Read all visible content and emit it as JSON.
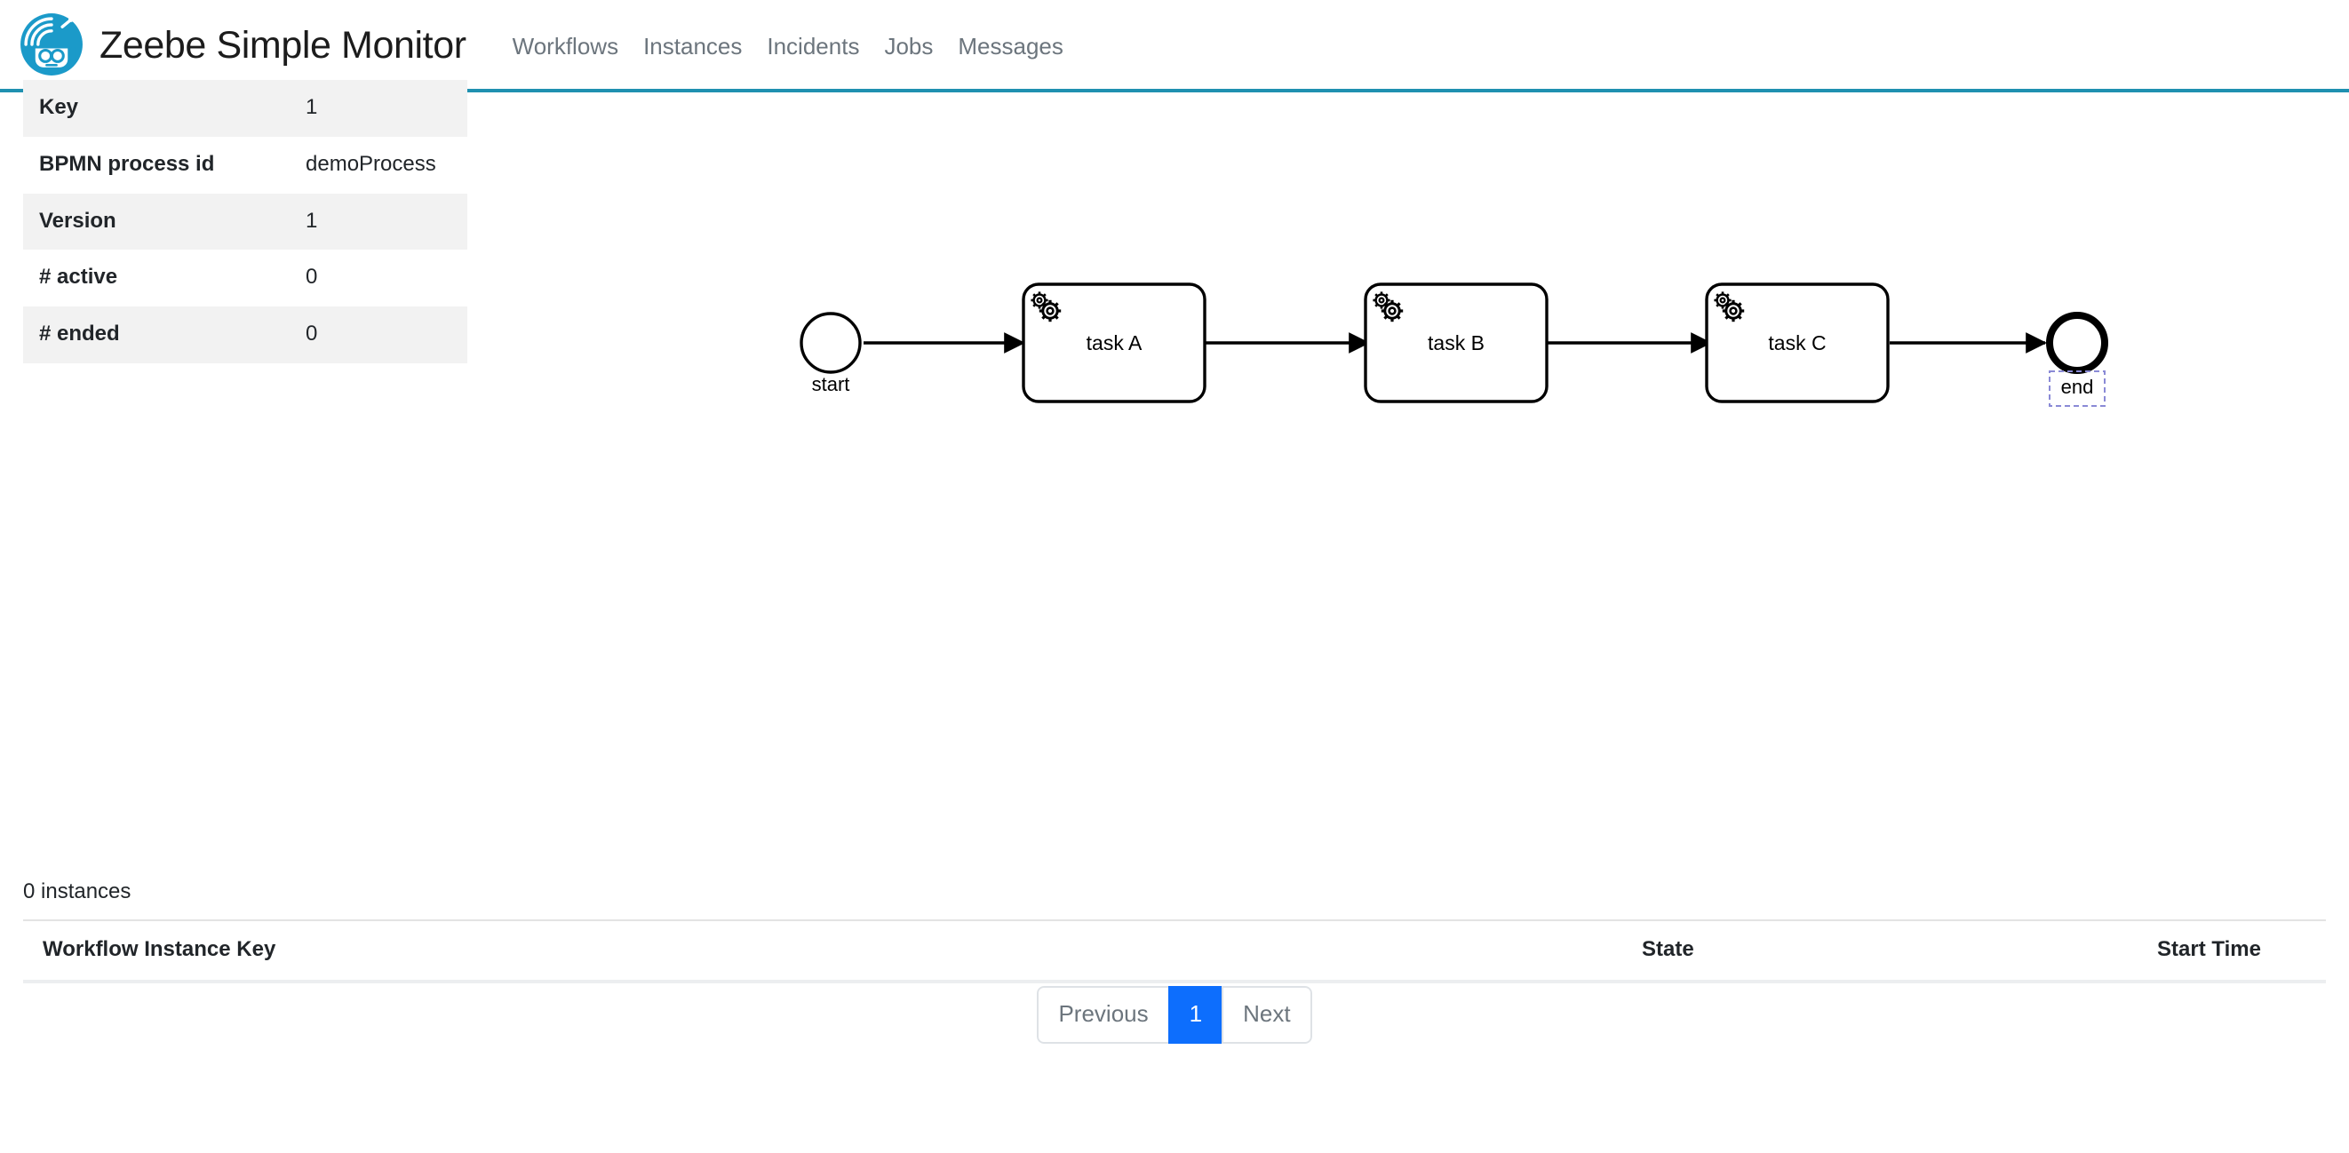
{
  "header": {
    "brand_title": "Zeebe Simple Monitor",
    "logo_icon": "zeebe-robot-logo",
    "accent_color": "#1f90b0",
    "nav": [
      {
        "label": "Workflows",
        "name": "workflows"
      },
      {
        "label": "Instances",
        "name": "instances"
      },
      {
        "label": "Incidents",
        "name": "incidents"
      },
      {
        "label": "Jobs",
        "name": "jobs"
      },
      {
        "label": "Messages",
        "name": "messages"
      }
    ]
  },
  "properties": {
    "rows": [
      {
        "key": "Key",
        "value": "1"
      },
      {
        "key": "BPMN process id",
        "value": "demoProcess"
      },
      {
        "key": "Version",
        "value": "1"
      },
      {
        "key": "# active",
        "value": "0"
      },
      {
        "key": "# ended",
        "value": "0"
      }
    ]
  },
  "diagram": {
    "type": "bpmn",
    "stroke_color": "#000000",
    "selection_color": "#8a8ad6",
    "elements": [
      {
        "id": "start",
        "type": "start-event",
        "label": "start",
        "selected": false
      },
      {
        "id": "taskA",
        "type": "service-task",
        "label": "task A",
        "marker": "gear-icon",
        "selected": false
      },
      {
        "id": "taskB",
        "type": "service-task",
        "label": "task B",
        "marker": "gear-icon",
        "selected": false
      },
      {
        "id": "taskC",
        "type": "service-task",
        "label": "task C",
        "marker": "gear-icon",
        "selected": false
      },
      {
        "id": "end",
        "type": "end-event",
        "label": "end",
        "selected": true
      }
    ],
    "flows": [
      {
        "from": "start",
        "to": "taskA"
      },
      {
        "from": "taskA",
        "to": "taskB"
      },
      {
        "from": "taskB",
        "to": "taskC"
      },
      {
        "from": "taskC",
        "to": "end"
      }
    ]
  },
  "instances": {
    "count_label": "0 instances",
    "columns": [
      {
        "label": "Workflow Instance Key",
        "name": "workflow-instance-key"
      },
      {
        "label": "State",
        "name": "state"
      },
      {
        "label": "Start Time",
        "name": "start-time"
      }
    ],
    "rows": []
  },
  "pagination": {
    "previous_label": "Previous",
    "next_label": "Next",
    "pages": [
      "1"
    ],
    "active_page": "1",
    "active_color": "#0d6efd"
  }
}
